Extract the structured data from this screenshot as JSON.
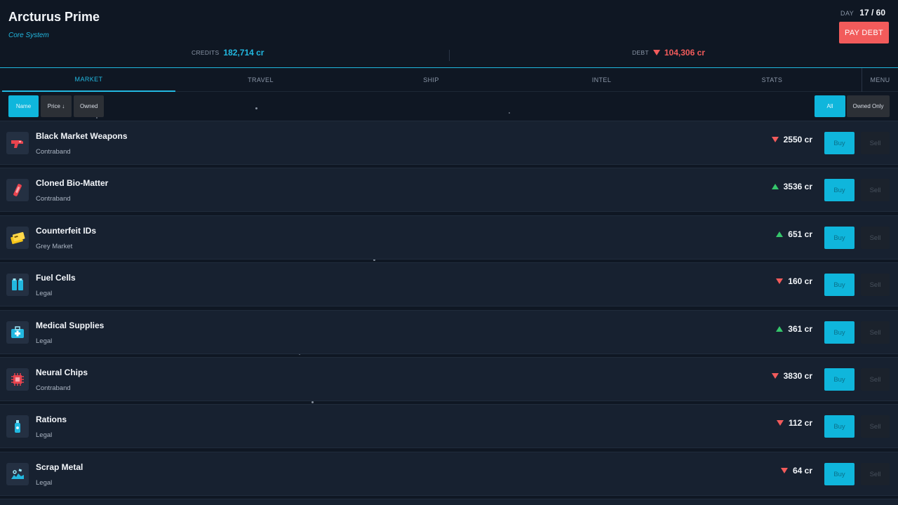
{
  "location": {
    "name": "Arcturus Prime",
    "subtitle": "Core System"
  },
  "day": {
    "label": "DAY",
    "value": "17 / 60"
  },
  "pay_debt_label": "PAY DEBT",
  "credits": {
    "label": "CREDITS",
    "value": "182,714 cr"
  },
  "debt": {
    "label": "DEBT",
    "value": "104,306 cr",
    "trend": "down"
  },
  "tabs": [
    {
      "label": "MARKET",
      "active": true
    },
    {
      "label": "TRAVEL"
    },
    {
      "label": "SHIP"
    },
    {
      "label": "INTEL"
    },
    {
      "label": "STATS"
    },
    {
      "label": "MENU"
    }
  ],
  "sort_filters": [
    {
      "label": "Name",
      "active": true
    },
    {
      "label": "Price ↓"
    },
    {
      "label": "Owned"
    }
  ],
  "view_filters": [
    {
      "label": "All",
      "active": true
    },
    {
      "label": "Owned Only"
    }
  ],
  "goods": [
    {
      "name": "Black Market Weapons",
      "category": "Contraband",
      "price": "2550 cr",
      "trend": "down",
      "icon": "blaster-icon",
      "buy": "Buy",
      "sell": "Sell"
    },
    {
      "name": "Cloned Bio-Matter",
      "category": "Contraband",
      "price": "3536 cr",
      "trend": "up",
      "icon": "vial-icon",
      "buy": "Buy",
      "sell": "Sell"
    },
    {
      "name": "Counterfeit IDs",
      "category": "Grey Market",
      "price": "651 cr",
      "trend": "up",
      "icon": "id-cards-icon",
      "buy": "Buy",
      "sell": "Sell"
    },
    {
      "name": "Fuel Cells",
      "category": "Legal",
      "price": "160 cr",
      "trend": "down",
      "icon": "fuel-cells-icon",
      "buy": "Buy",
      "sell": "Sell"
    },
    {
      "name": "Medical Supplies",
      "category": "Legal",
      "price": "361 cr",
      "trend": "up",
      "icon": "medkit-icon",
      "buy": "Buy",
      "sell": "Sell"
    },
    {
      "name": "Neural Chips",
      "category": "Contraband",
      "price": "3830 cr",
      "trend": "down",
      "icon": "chip-icon",
      "buy": "Buy",
      "sell": "Sell"
    },
    {
      "name": "Rations",
      "category": "Legal",
      "price": "112 cr",
      "trend": "down",
      "icon": "ration-bottle-icon",
      "buy": "Buy",
      "sell": "Sell"
    },
    {
      "name": "Scrap Metal",
      "category": "Legal",
      "price": "64 cr",
      "trend": "down",
      "icon": "scrap-pile-icon",
      "buy": "Buy",
      "sell": "Sell"
    }
  ],
  "colors": {
    "accent": "#22b8e0",
    "danger": "#f25b5b",
    "up": "#35c66b",
    "background": "#0f1723",
    "row": "#172130"
  }
}
